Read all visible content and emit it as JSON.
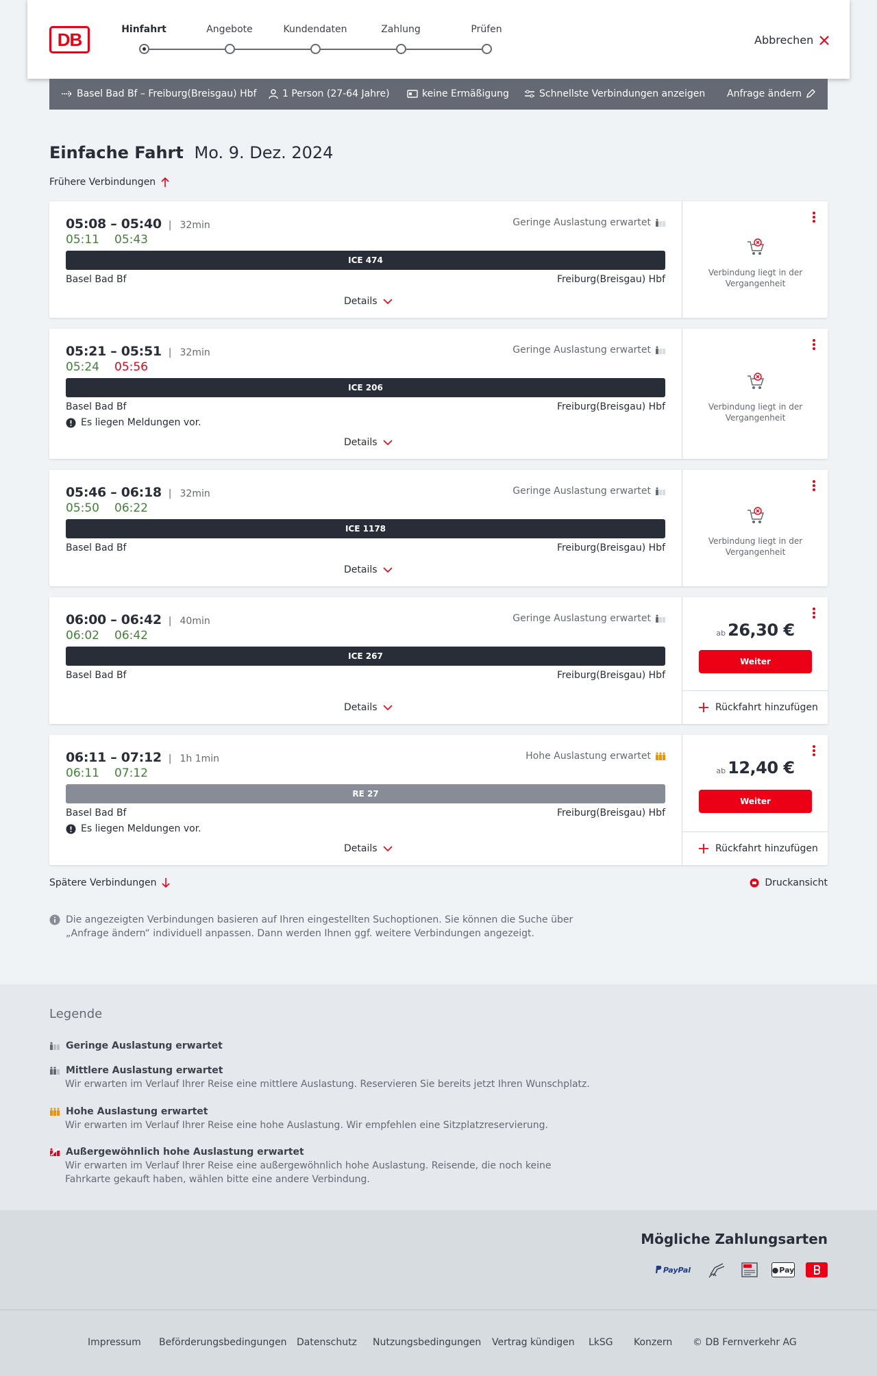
{
  "header": {
    "logo_text": "DB",
    "steps": [
      {
        "label": "Hinfahrt",
        "active": true
      },
      {
        "label": "Angebote",
        "active": false
      },
      {
        "label": "Kundendaten",
        "active": false
      },
      {
        "label": "Zahlung",
        "active": false
      },
      {
        "label": "Prüfen",
        "active": false
      }
    ],
    "cancel_label": "Abbrechen"
  },
  "search_bar": {
    "route": "Basel Bad Bf – Freiburg(Breisgau) Hbf",
    "passengers": "1 Person (27-64 Jahre)",
    "discount": "keine Ermäßigung",
    "fastest": "Schnellste Verbindungen anzeigen",
    "change": "Anfrage ändern"
  },
  "page": {
    "title_bold": "Einfache Fahrt",
    "title_date": "Mo. 9. Dez. 2024",
    "earlier": "Frühere Verbindungen",
    "later": "Spätere Verbindungen",
    "print": "Druckansicht",
    "info_text": "Die angezeigten Verbindungen basieren auf Ihren eingestellten Suchoptionen. Sie können die Suche über „Anfrage ändern“ individuell anpassen. Dann werden Ihnen ggf. weitere Verbindungen angezeigt."
  },
  "connections": [
    {
      "times": "05:08 – 05:40",
      "duration": "32min",
      "rt_dep": "05:11",
      "rt_arr": "05:43",
      "occupancy": "Geringe Auslastung erwartet",
      "train": "ICE 474",
      "from": "Basel Bad Bf",
      "to": "Freiburg(Breisgau) Hbf",
      "details": "Details",
      "past_text": "Verbindung liegt in der Vergangenheit"
    },
    {
      "times": "05:21 – 05:51",
      "duration": "32min",
      "rt_dep": "05:24",
      "rt_arr": "05:56",
      "occupancy": "Geringe Auslastung erwartet",
      "train": "ICE 206",
      "from": "Basel Bad Bf",
      "to": "Freiburg(Breisgau) Hbf",
      "message": "Es liegen Meldungen vor.",
      "details": "Details",
      "past_text": "Verbindung liegt in der Vergangenheit"
    },
    {
      "times": "05:46 – 06:18",
      "duration": "32min",
      "rt_dep": "05:50",
      "rt_arr": "06:22",
      "occupancy": "Geringe Auslastung erwartet",
      "train": "ICE 1178",
      "from": "Basel Bad Bf",
      "to": "Freiburg(Breisgau) Hbf",
      "details": "Details",
      "past_text": "Verbindung liegt in der Vergangenheit"
    },
    {
      "times": "06:00 – 06:42",
      "duration": "40min",
      "rt_dep": "06:02",
      "rt_arr": "06:42",
      "occupancy": "Geringe Auslastung erwartet",
      "train": "ICE 267",
      "from": "Basel Bad Bf",
      "to": "Freiburg(Breisgau) Hbf",
      "details": "Details",
      "price_prefix": "ab",
      "price": "26,30 €",
      "button": "Weiter",
      "return": "Rückfahrt hinzufügen"
    },
    {
      "times": "06:11 – 07:12",
      "duration": "1h 1min",
      "rt_dep": "06:11",
      "rt_arr": "07:12",
      "occupancy": "Hohe Auslastung erwartet",
      "train": "RE 27",
      "from": "Basel Bad Bf",
      "to": "Freiburg(Breisgau) Hbf",
      "message": "Es liegen Meldungen vor.",
      "details": "Details",
      "price_prefix": "ab",
      "price": "12,40 €",
      "button": "Weiter",
      "return": "Rückfahrt hinzufügen"
    }
  ],
  "colors": {
    "brand_red": "#ec0016",
    "ontime_green": "#408335",
    "bar_dark": "#282d37",
    "bar_grey": "#878c96",
    "high_occupancy": "#f39200"
  },
  "legend": {
    "title": "Legende",
    "items": [
      {
        "title": "Geringe Auslastung erwartet",
        "desc": ""
      },
      {
        "title": "Mittlere Auslastung erwartet",
        "desc": "Wir erwarten im Verlauf Ihrer Reise eine mittlere Auslastung. Reservieren Sie bereits jetzt Ihren Wunschplatz."
      },
      {
        "title": "Hohe Auslastung erwartet",
        "desc": "Wir erwarten im Verlauf Ihrer Reise eine hohe Auslastung. Wir empfehlen eine Sitzplatzreservierung."
      },
      {
        "title": "Außergewöhnlich hohe Auslastung erwartet",
        "desc": "Wir erwarten im Verlauf Ihrer Reise eine außergewöhnlich hohe Auslastung. Reisende, die noch keine Fahrkarte gekauft haben, wählen bitte eine andere Verbindung."
      }
    ]
  },
  "payment": {
    "title": "Mögliche Zahlungsarten",
    "paypal": "PayPal",
    "sepa": "SEPA",
    "applepay": "Pay"
  },
  "footer": {
    "links": [
      "Impressum",
      "Beförderungsbedingungen",
      "Datenschutz",
      "Nutzungsbedingungen",
      "Vertrag kündigen",
      "LkSG",
      "Konzern",
      "© DB Fernverkehr AG"
    ]
  }
}
